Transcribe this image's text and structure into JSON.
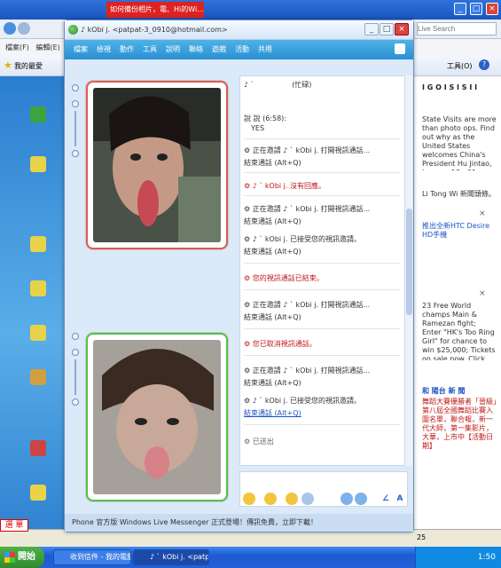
{
  "browser": {
    "red_tab": "如何備份相片，電、Hi的Wi...",
    "search_placeholder": "Live Search",
    "menu_items": [
      "檔案(F)",
      "編輯(E)"
    ],
    "fav_label": "我的最愛",
    "tools_label": "工具(O)",
    "side_header": "I G O I S I S I I",
    "side_news": [
      "State Visits are more than photo ops. Find out why as the United States welcomes China's President Hu Jintao, January 18 - 21.",
      "Li Tong Wi 新聞頭條。",
      "推出全新HTC Desire HD手機",
      "23 Free World champs Main & Ramezan fight; Enter \"HK's Too Ring Girl\" for chance to win $25,000; Tickets on sale now. Click for info",
      "和 陽台 新 聞",
      "舞蹈大賽優勝者「晉級」第八屆全國舞蹈比賽入圍名單，聯合報，新一代大師，第一集影片，大華，上市中【活動日期】"
    ],
    "status_left": "25"
  },
  "messenger": {
    "title": "♪ kObi j. <patpat-3_0910@hotmail.com>",
    "menu": [
      "檔案",
      "檢視",
      "動作",
      "工具",
      "說明",
      "聯絡",
      "遊戲",
      "活動",
      "共用"
    ],
    "contact_header": "♪ ` 　　　　　(忙碌)",
    "messages": [
      {
        "text": "說 說 (6:58):",
        "style": "normal"
      },
      {
        "text": "YES",
        "style": "normal"
      },
      {
        "text": "⚙ 正在邀請 ♪ ` kObi j. 打開視訊通話...",
        "style": "normal"
      },
      {
        "text": "結束通話 (Alt+Q)",
        "style": "normal"
      },
      {
        "text": "⚙ ♪ ` kObi j. 沒有回應。",
        "style": "red"
      },
      {
        "text": "⚙ 正在邀請 ♪ ` kObi j. 打開視訊通話...",
        "style": "normal"
      },
      {
        "text": "結束通話 (Alt+Q)",
        "style": "normal"
      },
      {
        "text": "⚙ ♪ ` kObi j. 已接受您的視訊邀請。",
        "style": "normal"
      },
      {
        "text": "結束通話 (Alt+Q)",
        "style": "normal"
      },
      {
        "text": "⚙ 您的視訊通話已結束。",
        "style": "red"
      },
      {
        "text": "⚙ 正在邀請 ♪ ` kObi j. 打開視訊通話...",
        "style": "normal"
      },
      {
        "text": "結束通話 (Alt+Q)",
        "style": "normal"
      },
      {
        "text": "⚙ 您已取消視訊通話。",
        "style": "red"
      },
      {
        "text": "⚙ 正在邀請 ♪ ` kObi j. 打開視訊通話...",
        "style": "normal"
      },
      {
        "text": "結束通話 (Alt+Q)",
        "style": "normal"
      },
      {
        "text": "⚙ ♪ ` kObi j. 已接受您的視訊邀請。",
        "style": "normal"
      },
      {
        "text": "結束通話 (Alt+Q)",
        "style": "blue"
      },
      {
        "text": "⚙ 已送出",
        "style": "normal"
      }
    ],
    "footer": "Phone 官方版 Windows Live Messenger 正式登場！傳訊免費，立即下載！"
  },
  "taskbar": {
    "start_label": "開始",
    "buttons": [
      "收到信件 - 我的電腦...",
      "♪ ` kObi j. <patpat-3..."
    ],
    "clock": "1:50"
  },
  "desktop": {
    "corner_label": "選 單"
  },
  "colors": {
    "messenger_menu": "#2b8fd2",
    "cam_red_border": "#e05a52",
    "cam_green_border": "#4fc24a",
    "taskbar": "#2560d8"
  }
}
